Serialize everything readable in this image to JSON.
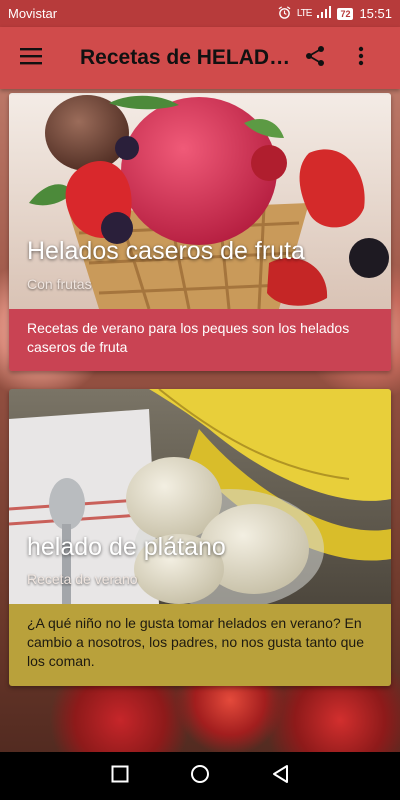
{
  "status_bar": {
    "carrier": "Movistar",
    "network": "LTE",
    "battery": "72",
    "time": "15:51"
  },
  "app_bar": {
    "title": "Recetas de HELADOS",
    "menu_icon": "hamburger-menu-icon",
    "share_icon": "share-icon",
    "overflow_icon": "more-vert-icon"
  },
  "cards": [
    {
      "title": "Helados caseros de fruta",
      "subtitle": "Con frutas",
      "description": "Recetas de verano para los peques son los helados caseros de fruta",
      "accent_color": "#c94353"
    },
    {
      "title": "helado de plátano",
      "subtitle": "Receta de verano",
      "description": "¿A qué niño no le gusta tomar helados en verano? En cambio a nosotros, los padres, no nos gusta tanto que los coman.",
      "accent_color": "#b9a13b"
    }
  ],
  "nav_bar": {
    "recents_icon": "square-recents-icon",
    "home_icon": "circle-home-icon",
    "back_icon": "triangle-back-icon"
  },
  "colors": {
    "status_bar": "#b73b3b",
    "app_bar": "#d04b4b"
  }
}
